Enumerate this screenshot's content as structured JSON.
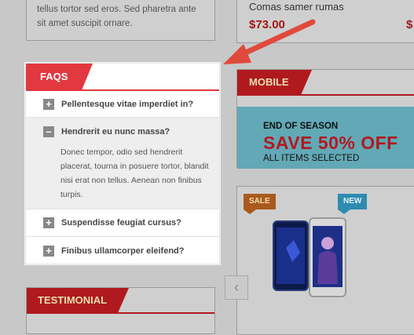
{
  "top_left": {
    "text": "tellus tortor sed eros. Sed pharetra ante sit amet suscipit ornare."
  },
  "top_right": {
    "product_name": "Comas samer rumas",
    "price": "$73.00",
    "price_cut": "$"
  },
  "faq": {
    "title": "FAQS",
    "items": [
      {
        "icon": "+",
        "question": "Pellentesque vitae imperdiet in?"
      },
      {
        "icon": "–",
        "question": "Hendrerit eu nunc massa?",
        "answer": "Donec tempor, odio sed hendrerit placerat, tourna in posuere tortor, blandit nisi erat non tellus. Aenean non finibus turpis."
      },
      {
        "icon": "+",
        "question": "Suspendisse feugiat cursus?"
      },
      {
        "icon": "+",
        "question": "Finibus ullamcorper eleifend?"
      }
    ]
  },
  "mobile": {
    "title": "MOBILE",
    "banner_line1": "END OF SEASON",
    "banner_line2": "SAVE 50% OFF",
    "banner_line3": "ALL ITEMS SELECTED"
  },
  "product_card": {
    "sale_flag": "SALE",
    "new_flag": "NEW"
  },
  "testimonial": {
    "title": "TESTIMONIAL"
  },
  "icons": {
    "prev": "chevron-left-icon",
    "pointer": "red-arrow-annotation"
  },
  "colors": {
    "accent": "#e2383f",
    "banner": "#62a8b6"
  }
}
